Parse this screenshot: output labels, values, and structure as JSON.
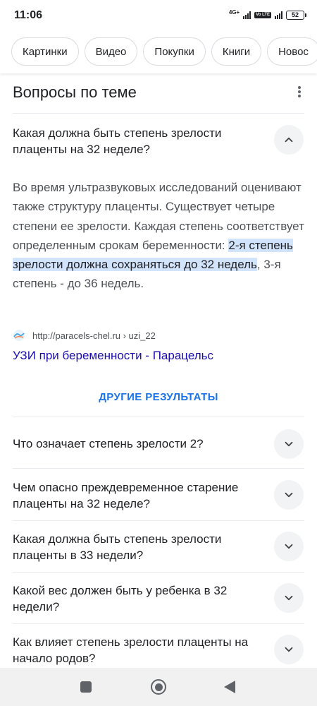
{
  "status_bar": {
    "time": "11:06",
    "network": "4G+",
    "volte": "Vo LTE",
    "battery": "52"
  },
  "chips": [
    "Картинки",
    "Видео",
    "Покупки",
    "Книги",
    "Новос"
  ],
  "section": {
    "title": "Вопросы по теме"
  },
  "expanded_question": {
    "question": "Какая должна быть степень зрелости плаценты на 32 неделе?",
    "answer_before": "Во время ультразвуковых исследований оценивают также структуру плаценты. Существует четыре степени ее зрелости. Каждая степень соответствует определенным срокам беременности: ",
    "answer_highlight": "2-я степень зрелости должна сохраняться до 32 недель",
    "answer_after": ", 3-я степень - до 36 недель.",
    "source_url": "http://paracels-chel.ru › uzi_22",
    "source_title": "УЗИ при беременности - Парацельс"
  },
  "more_results_label": "ДРУГИЕ РЕЗУЛЬТАТЫ",
  "questions": [
    "Что означает степень зрелости 2?",
    "Чем опасно преждевременное старение плаценты на 32 неделе?",
    "Какая должна быть степень зрелости плаценты в 33 недели?",
    "Какой вес должен быть у ребенка в 32 недели?",
    "Как влияет степень зрелости плаценты на начало родов?"
  ],
  "colors": {
    "link": "#1a0dab",
    "accent": "#1a73e8",
    "highlight": "#d2e3fc"
  }
}
